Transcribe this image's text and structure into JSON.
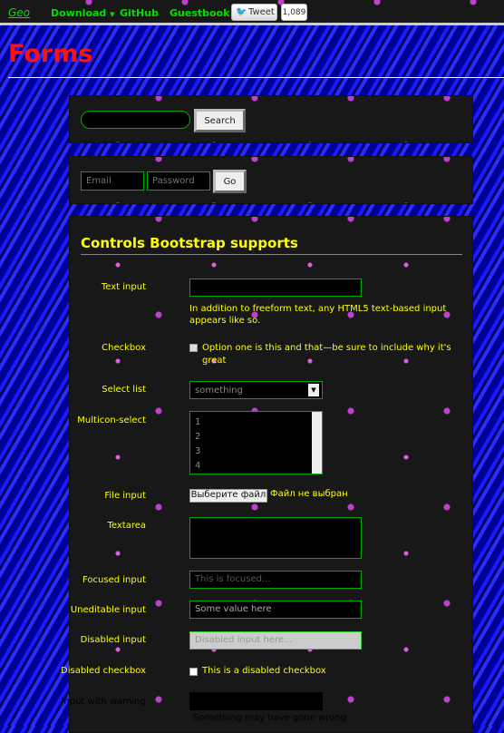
{
  "nav": {
    "brand": "Geo",
    "items": [
      "Download",
      "GitHub",
      "Guestbook"
    ],
    "tweet": "Tweet",
    "tweet_count": "1,089"
  },
  "page_title": "Forms",
  "search_form": {
    "button": "Search"
  },
  "signin_form": {
    "email_placeholder": "Email",
    "password_placeholder": "Password",
    "button": "Go"
  },
  "controls": {
    "legend": "Controls Bootstrap supports",
    "text_input": {
      "label": "Text input",
      "help": "In addition to freeform text, any HTML5 text-based input appears like so."
    },
    "checkbox": {
      "label": "Checkbox",
      "text": "Option one is this and that—be sure to include why it's great"
    },
    "select": {
      "label": "Select list",
      "value": "something"
    },
    "multiselect": {
      "label": "Multicon-select",
      "options": [
        "1",
        "2",
        "3",
        "4"
      ]
    },
    "file": {
      "label": "File input",
      "button": "Выберите файл",
      "status": "Файл не выбран"
    },
    "textarea": {
      "label": "Textarea"
    },
    "focused": {
      "label": "Focused input",
      "value": "This is focused..."
    },
    "uneditable": {
      "label": "Uneditable input",
      "value": "Some value here"
    },
    "disabled": {
      "label": "Disabled input",
      "placeholder": "Disabled input here..."
    },
    "disabled_checkbox": {
      "label": "Disabled checkbox",
      "text": "This is a disabled checkbox"
    },
    "warning": {
      "label": "Input with warning",
      "help": "Something may have gone wrong"
    }
  }
}
